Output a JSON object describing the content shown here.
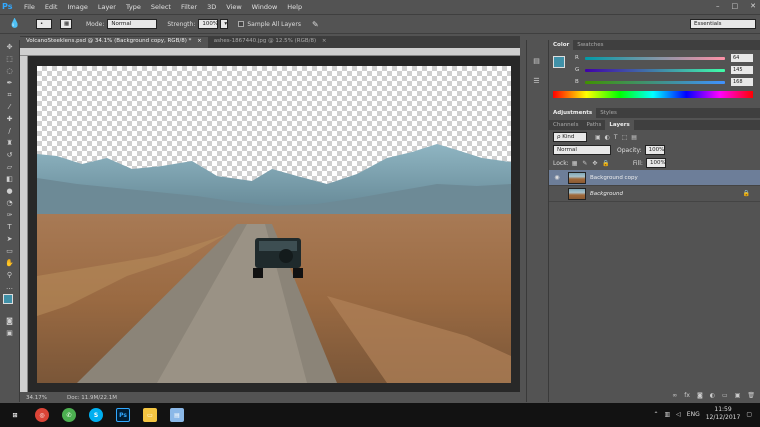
{
  "app": {
    "logo": "Ps"
  },
  "menu": [
    "File",
    "Edit",
    "Image",
    "Layer",
    "Type",
    "Select",
    "Filter",
    "3D",
    "View",
    "Window",
    "Help"
  ],
  "window_controls": {
    "minimize": "–",
    "maximize": "□",
    "close": "✕"
  },
  "options": {
    "mode_label": "Mode:",
    "mode_value": "Normal",
    "strength_label": "Strength:",
    "strength_value": "100%",
    "sample_all_layers": "Sample All Layers",
    "workspace": "Essentials"
  },
  "documents": {
    "tabs": [
      {
        "label": "VolcanoSteeklens.psd @ 34.1% (Background copy, RGB/8) *",
        "close": "×"
      },
      {
        "label": "ashes-1867440.jpg @ 12.5% (RGB/8)",
        "close": "×"
      }
    ]
  },
  "status": {
    "zoom": "34.17%",
    "doc": "Doc: 11.9M/22.1M"
  },
  "color_panel": {
    "tabs": [
      "Color",
      "Swatches"
    ],
    "r_label": "R",
    "r_value": "64",
    "g_label": "G",
    "g_value": "145",
    "b_label": "B",
    "b_value": "168",
    "foreground": "#4091a8"
  },
  "adjustments": {
    "tabs": [
      "Adjustments",
      "Styles"
    ]
  },
  "layers_panel": {
    "tabs": [
      "Channels",
      "Paths",
      "Layers"
    ],
    "kind": "ρ Kind",
    "blend": "Normal",
    "opacity_label": "Opacity:",
    "opacity_value": "100%",
    "lock_label": "Lock:",
    "fill_label": "Fill:",
    "fill_value": "100%",
    "layers": [
      {
        "name": "Background copy",
        "visible": "◉"
      },
      {
        "name": "Background",
        "visible": ""
      }
    ]
  },
  "taskbar": {
    "lang": "ENG",
    "time": "11:59",
    "date": "12/12/2017"
  }
}
